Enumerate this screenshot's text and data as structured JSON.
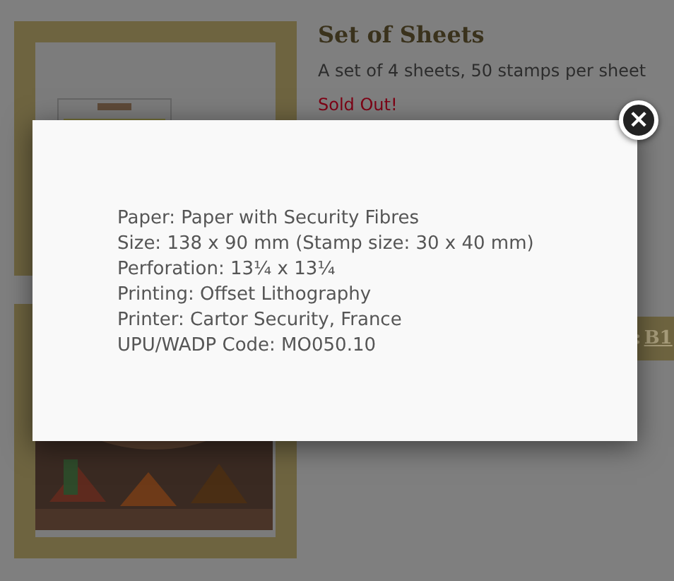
{
  "product": {
    "title": "Set of Sheets",
    "description": "A set of 4 sheets, 50 stamps per sheet",
    "status": "Sold Out!"
  },
  "code_bar": {
    "separator": ":",
    "link": "B1"
  },
  "modal": {
    "close": "×",
    "lines": [
      "Paper: Paper with Security Fibres",
      "Size: 138 x 90 mm (Stamp size: 30 x 40 mm)",
      "Perforation: 13¼ x 13¼",
      "Printing: Offset Lithography",
      "Printer: Cartor Security, France",
      "UPU/WADP Code: MO050.10"
    ]
  }
}
